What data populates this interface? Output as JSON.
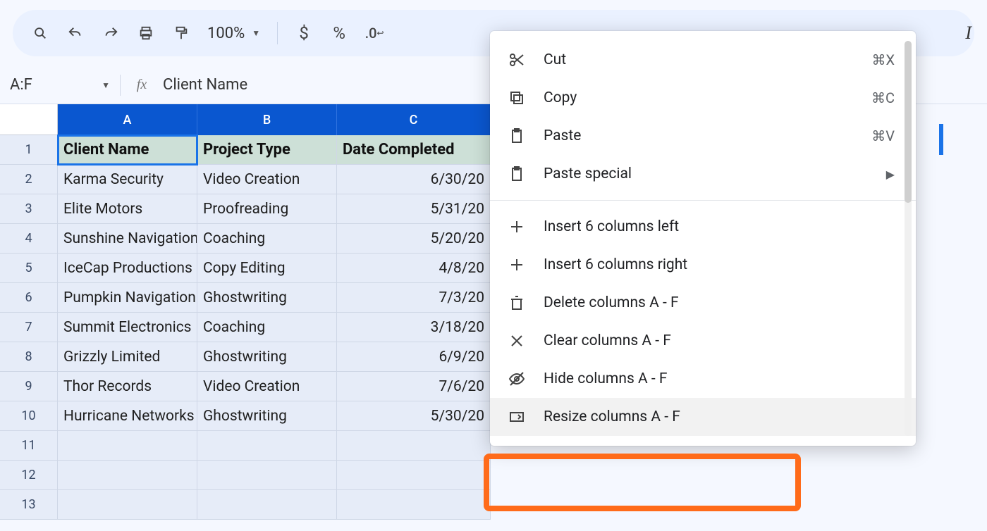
{
  "toolbar": {
    "zoom": "100%",
    "currency": "$",
    "percent": "%",
    "decimal_dec": ".0"
  },
  "namebox": {
    "range": "A:F"
  },
  "formula": {
    "value": "Client Name"
  },
  "columns": {
    "A": "A",
    "B": "B",
    "C": "C"
  },
  "header_row": {
    "A": "Client Name",
    "B": "Project Type",
    "C": "Date Completed"
  },
  "rows": [
    {
      "A": "Karma Security",
      "B": "Video Creation",
      "C": "6/30/20"
    },
    {
      "A": "Elite Motors",
      "B": "Proofreading",
      "C": "5/31/20"
    },
    {
      "A": "Sunshine Navigation",
      "B": "Coaching",
      "C": "5/20/20"
    },
    {
      "A": "IceCap Productions",
      "B": "Copy Editing",
      "C": "4/8/20"
    },
    {
      "A": "Pumpkin Navigation",
      "B": "Ghostwriting",
      "C": "7/3/20"
    },
    {
      "A": "Summit Electronics",
      "B": "Coaching",
      "C": "3/18/20"
    },
    {
      "A": "Grizzly Limited",
      "B": "Ghostwriting",
      "C": "6/9/20"
    },
    {
      "A": "Thor Records",
      "B": "Video Creation",
      "C": "7/6/20"
    },
    {
      "A": "Hurricane Networks",
      "B": "Ghostwriting",
      "C": "5/30/20"
    }
  ],
  "row_nums": [
    "1",
    "2",
    "3",
    "4",
    "5",
    "6",
    "7",
    "8",
    "9",
    "10",
    "11",
    "12",
    "13"
  ],
  "menu": {
    "cut": {
      "label": "Cut",
      "shortcut": "⌘X"
    },
    "copy": {
      "label": "Copy",
      "shortcut": "⌘C"
    },
    "paste": {
      "label": "Paste",
      "shortcut": "⌘V"
    },
    "paste_special": {
      "label": "Paste special"
    },
    "insert_left": {
      "label": "Insert 6 columns left"
    },
    "insert_right": {
      "label": "Insert 6 columns right"
    },
    "delete": {
      "label": "Delete columns A - F"
    },
    "clear": {
      "label": "Clear columns A - F"
    },
    "hide": {
      "label": "Hide columns A - F"
    },
    "resize": {
      "label": "Resize columns A - F"
    }
  },
  "right_italic": "I"
}
